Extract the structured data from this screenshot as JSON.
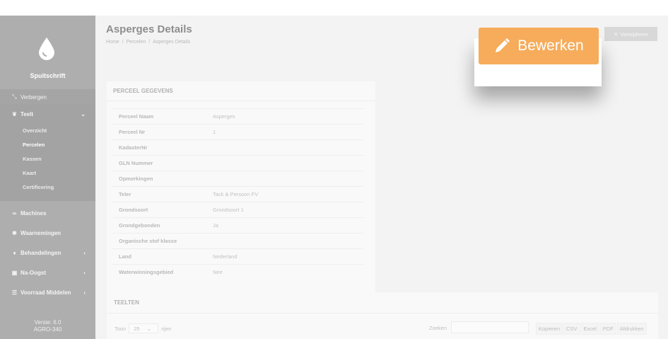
{
  "sidebar": {
    "brand": "Spuitschrift",
    "hide_label": "Verbergen",
    "teelt_label": "Teelt",
    "sub_items": [
      "Overzicht",
      "Percelen",
      "Kassen",
      "Kaart",
      "Certificering"
    ],
    "items": [
      {
        "label": "Machines",
        "icon": "binoculars-icon"
      },
      {
        "label": "Waarnemingen",
        "icon": "bug-icon"
      },
      {
        "label": "Behandelingen",
        "icon": "flask-icon"
      },
      {
        "label": "Na-Oogst",
        "icon": "archive-icon"
      },
      {
        "label": "Voorraad Middelen",
        "icon": "list-icon"
      }
    ],
    "version_line1": "Versie: 6.0",
    "version_line2": "AGRO-340"
  },
  "header": {
    "title": "Asperges Details",
    "breadcrumb": [
      "Home",
      "/",
      "Percelen",
      "/",
      "Asperges Details"
    ]
  },
  "actions": {
    "edit_label": "Bewerken",
    "delete_label": "Verwijderen"
  },
  "perceel": {
    "title": "PERCEEL GEGEVENS",
    "rows": [
      {
        "key": "Perceel Naam",
        "value": "Asperges"
      },
      {
        "key": "Perceel Nr",
        "value": "1"
      },
      {
        "key": "KadasterNr",
        "value": ""
      },
      {
        "key": "GLN Nummer",
        "value": ""
      },
      {
        "key": "Opmerkingen",
        "value": ""
      },
      {
        "key": "Teler",
        "value": "Tack & Persoon FV"
      },
      {
        "key": "Grondsoort",
        "value": "Grondsoort 1"
      },
      {
        "key": "Grondgebonden",
        "value": "Ja"
      },
      {
        "key": "Organische stof klasse",
        "value": ""
      },
      {
        "key": "Land",
        "value": "Nederland"
      },
      {
        "key": "Waterwinningsgebied",
        "value": "Nee"
      }
    ]
  },
  "teelten": {
    "title": "TEELTEN",
    "show_label": "Toon",
    "page_length": "25",
    "rows_label": "rijen",
    "search_label": "Zoeken",
    "export_buttons": [
      "Kopieren",
      "CSV",
      "Excel",
      "PDF",
      "Afdrukken"
    ]
  },
  "colors": {
    "accent": "#f6ac5b",
    "sidebar": "#aeaeae"
  }
}
